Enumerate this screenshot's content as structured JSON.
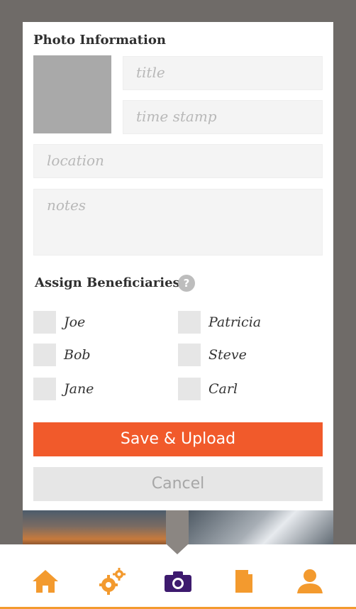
{
  "photo_info": {
    "title": "Photo Information",
    "fields": {
      "title_placeholder": "title",
      "timestamp_placeholder": "time stamp",
      "location_placeholder": "location",
      "notes_placeholder": "notes"
    }
  },
  "beneficiaries": {
    "title": "Assign Beneficiaries",
    "help_icon": "?",
    "names": [
      "Joe",
      "Patricia",
      "Bob",
      "Steve",
      "Jane",
      "Carl"
    ]
  },
  "buttons": {
    "save": "Save & Upload",
    "cancel": "Cancel"
  },
  "nav": {
    "items": [
      "home-icon",
      "settings-gears-icon",
      "camera-icon",
      "document-icon",
      "profile-icon"
    ],
    "active": "camera-icon"
  },
  "colors": {
    "accent_orange": "#f15a2b",
    "nav_orange": "#f39a2e",
    "nav_active": "#3d1a6e"
  }
}
